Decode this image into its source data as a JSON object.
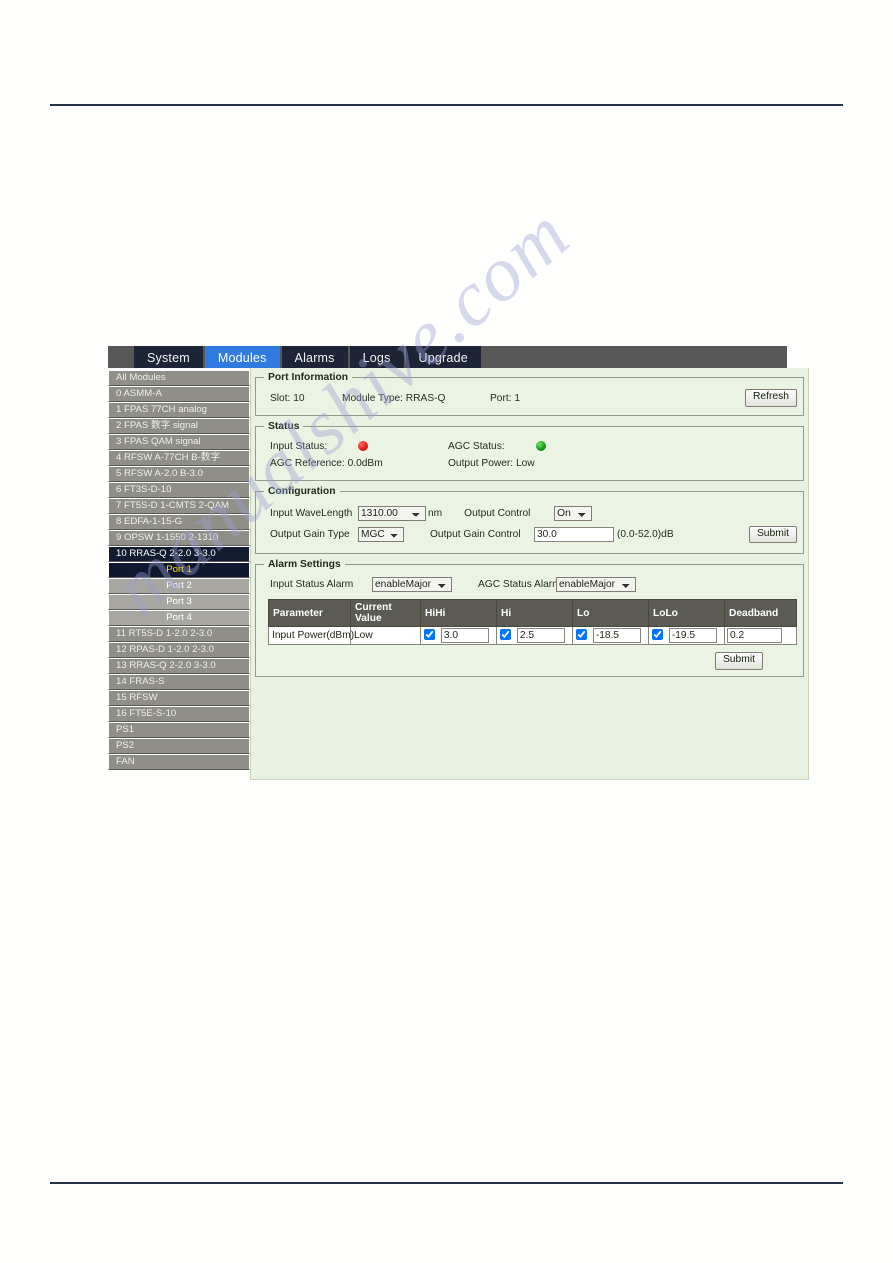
{
  "tabs": [
    {
      "label": "System",
      "active": false
    },
    {
      "label": "Modules",
      "active": true
    },
    {
      "label": "Alarms",
      "active": false
    },
    {
      "label": "Logs",
      "active": false
    },
    {
      "label": "Upgrade",
      "active": false
    }
  ],
  "sidebar": {
    "items": [
      {
        "label": "All Modules",
        "type": "module",
        "selected": false
      },
      {
        "label": "0 ASMM-A",
        "type": "module",
        "selected": false
      },
      {
        "label": "1 FPAS 77CH analog",
        "type": "module",
        "selected": false
      },
      {
        "label": "2 FPAS 数字 signal",
        "type": "module",
        "selected": false
      },
      {
        "label": "3 FPAS QAM signal",
        "type": "module",
        "selected": false
      },
      {
        "label": "4 RFSW A-77CH B-数字",
        "type": "module",
        "selected": false
      },
      {
        "label": "5 RFSW A-2.0 B-3.0",
        "type": "module",
        "selected": false
      },
      {
        "label": "6 FT3S-D-10",
        "type": "module",
        "selected": false
      },
      {
        "label": "7 FT5S-D 1-CMTS 2-QAM",
        "type": "module",
        "selected": false
      },
      {
        "label": "8 EDFA-1-15-G",
        "type": "module",
        "selected": false
      },
      {
        "label": "9 OPSW 1-1550 2-1310",
        "type": "module",
        "selected": false
      },
      {
        "label": "10 RRAS-Q 2-2.0 3-3.0",
        "type": "module",
        "selected": true
      },
      {
        "label": "Port 1",
        "type": "port",
        "selected": true
      },
      {
        "label": "Port 2",
        "type": "port",
        "selected": false
      },
      {
        "label": "Port 3",
        "type": "port",
        "selected": false
      },
      {
        "label": "Port 4",
        "type": "port",
        "selected": false
      },
      {
        "label": "11 RT5S-D 1-2.0 2-3.0",
        "type": "module",
        "selected": false
      },
      {
        "label": "12 RPAS-D 1-2.0 2-3.0",
        "type": "module",
        "selected": false
      },
      {
        "label": "13 RRAS-Q 2-2.0 3-3.0",
        "type": "module",
        "selected": false
      },
      {
        "label": "14 FRAS-S",
        "type": "module",
        "selected": false
      },
      {
        "label": "15 RFSW",
        "type": "module",
        "selected": false
      },
      {
        "label": "16 FT5E-S-10",
        "type": "module",
        "selected": false
      },
      {
        "label": "PS1",
        "type": "module",
        "selected": false
      },
      {
        "label": "PS2",
        "type": "module",
        "selected": false
      },
      {
        "label": "FAN",
        "type": "module",
        "selected": false
      }
    ]
  },
  "port_information": {
    "legend": "Port Information",
    "slot": "Slot: 10",
    "module_type": "Module Type: RRAS-Q",
    "port": "Port: 1",
    "refresh_label": "Refresh"
  },
  "status": {
    "legend": "Status",
    "input_status_label": "Input Status:",
    "input_status_color": "#de1f14",
    "agc_status_label": "AGC Status:",
    "agc_status_color": "#14a018",
    "agc_reference": "AGC Reference: 0.0dBm",
    "output_power": "Output Power: Low"
  },
  "configuration": {
    "legend": "Configuration",
    "input_wavelength_label": "Input WaveLength",
    "input_wavelength_value": "1310.00",
    "input_wavelength_unit": "nm",
    "output_gain_type_label": "Output Gain Type",
    "output_gain_type_value": "MGC",
    "output_control_label": "Output Control",
    "output_control_value": "On",
    "output_gain_control_label": "Output Gain Control",
    "output_gain_control_value": "30.0",
    "output_gain_control_range": "(0.0-52.0)dB",
    "submit_label": "Submit"
  },
  "alarm_settings": {
    "legend": "Alarm Settings",
    "input_status_alarm_label": "Input Status Alarm",
    "input_status_alarm_value": "enableMajor",
    "agc_status_alarm_label": "AGC Status Alarm",
    "agc_status_alarm_value": "enableMajor",
    "columns": [
      "Parameter",
      "Current Value",
      "HiHi",
      "Hi",
      "Lo",
      "LoLo",
      "Deadband"
    ],
    "rows": [
      {
        "parameter": "Input Power(dBm)",
        "current_value": "Low",
        "hihi": {
          "checked": true,
          "value": "3.0"
        },
        "hi": {
          "checked": true,
          "value": "2.5"
        },
        "lo": {
          "checked": true,
          "value": "-18.5"
        },
        "lolo": {
          "checked": true,
          "value": "-19.5"
        },
        "deadband": "0.2"
      }
    ],
    "submit_label": "Submit"
  },
  "watermark": {
    "text": "manualshive.com"
  }
}
